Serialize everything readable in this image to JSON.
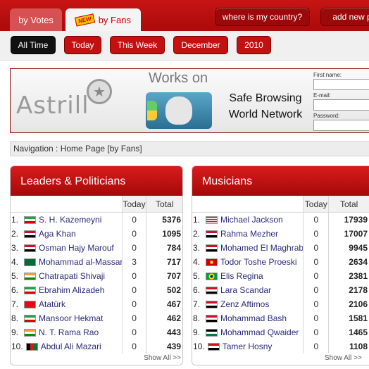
{
  "tabs": {
    "votes_label": "by Votes",
    "fans_badge": "NEW",
    "fans_label": "by Fans"
  },
  "top_buttons": {
    "country_label": "where is my country?",
    "addnew_label": "add new p"
  },
  "periods": [
    {
      "label": "All Time",
      "active": true
    },
    {
      "label": "Today",
      "active": false
    },
    {
      "label": "This Week",
      "active": false
    },
    {
      "label": "December",
      "active": false
    },
    {
      "label": "2010",
      "active": false
    }
  ],
  "ad": {
    "brand": "Astrill",
    "works_on": "Works on",
    "line1": "Safe Browsing",
    "line2": "World Network",
    "first_name_label": "First name:",
    "email_label": "E-mail:",
    "password_label": "Password:"
  },
  "navigation": "Navigation : Home Page [by Fans]",
  "panels": [
    {
      "title": "Leaders & Politicians",
      "col_today": "Today",
      "col_total": "Total",
      "show_all": "Show All >>",
      "rows": [
        {
          "num": "1.",
          "name": "S. H. Kazemeyni",
          "flag": "iran",
          "today": "0",
          "total": "5376"
        },
        {
          "num": "2.",
          "name": "Aga Khan",
          "flag": "iraq",
          "today": "0",
          "total": "1095"
        },
        {
          "num": "3.",
          "name": "Osman Hajy Marouf",
          "flag": "iraq",
          "today": "0",
          "total": "784"
        },
        {
          "num": "4.",
          "name": "Mohammad al-Massari",
          "flag": "saudi",
          "today": "3",
          "total": "717"
        },
        {
          "num": "5.",
          "name": "Chatrapati Shivaji",
          "flag": "india",
          "today": "0",
          "total": "707"
        },
        {
          "num": "6.",
          "name": "Ebrahim Alizadeh",
          "flag": "iran",
          "today": "0",
          "total": "502"
        },
        {
          "num": "7.",
          "name": "Atatürk",
          "flag": "turkey",
          "today": "0",
          "total": "467"
        },
        {
          "num": "8.",
          "name": "Mansoor Hekmat",
          "flag": "iran",
          "today": "0",
          "total": "462"
        },
        {
          "num": "9.",
          "name": "N. T. Rama Rao",
          "flag": "india",
          "today": "0",
          "total": "443"
        },
        {
          "num": "10.",
          "name": "Abdul Ali Mazari",
          "flag": "afghan",
          "today": "0",
          "total": "439"
        }
      ]
    },
    {
      "title": "Musicians",
      "col_today": "Today",
      "col_total": "Total",
      "show_all": "Show All >>",
      "rows": [
        {
          "num": "1.",
          "name": "Michael Jackson",
          "flag": "usa",
          "today": "0",
          "total": "17939"
        },
        {
          "num": "2.",
          "name": "Rahma Mezher",
          "flag": "iraq",
          "today": "0",
          "total": "17007"
        },
        {
          "num": "3.",
          "name": "Mohamed El Maghraby",
          "flag": "egypt",
          "today": "0",
          "total": "9945"
        },
        {
          "num": "4.",
          "name": "Todor Toshe Proeski",
          "flag": "macedonia",
          "today": "0",
          "total": "2634"
        },
        {
          "num": "5.",
          "name": "Elis Regina",
          "flag": "brazil",
          "today": "0",
          "total": "2381"
        },
        {
          "num": "6.",
          "name": "Lara Scandar",
          "flag": "egypt",
          "today": "0",
          "total": "2178"
        },
        {
          "num": "7.",
          "name": "Zenz Aftimos",
          "flag": "egypt",
          "today": "0",
          "total": "2106"
        },
        {
          "num": "8.",
          "name": "Mohammad Bash",
          "flag": "iraq",
          "today": "0",
          "total": "1581"
        },
        {
          "num": "9.",
          "name": "Mohammad Qwaider",
          "flag": "jordan",
          "today": "0",
          "total": "1465"
        },
        {
          "num": "10.",
          "name": "Tamer Hosny",
          "flag": "egypt",
          "today": "0",
          "total": "1108"
        }
      ]
    }
  ],
  "colors": {
    "brand_red": "#c31010",
    "dark_red": "#9b0a0a",
    "active_period": "#111111"
  }
}
